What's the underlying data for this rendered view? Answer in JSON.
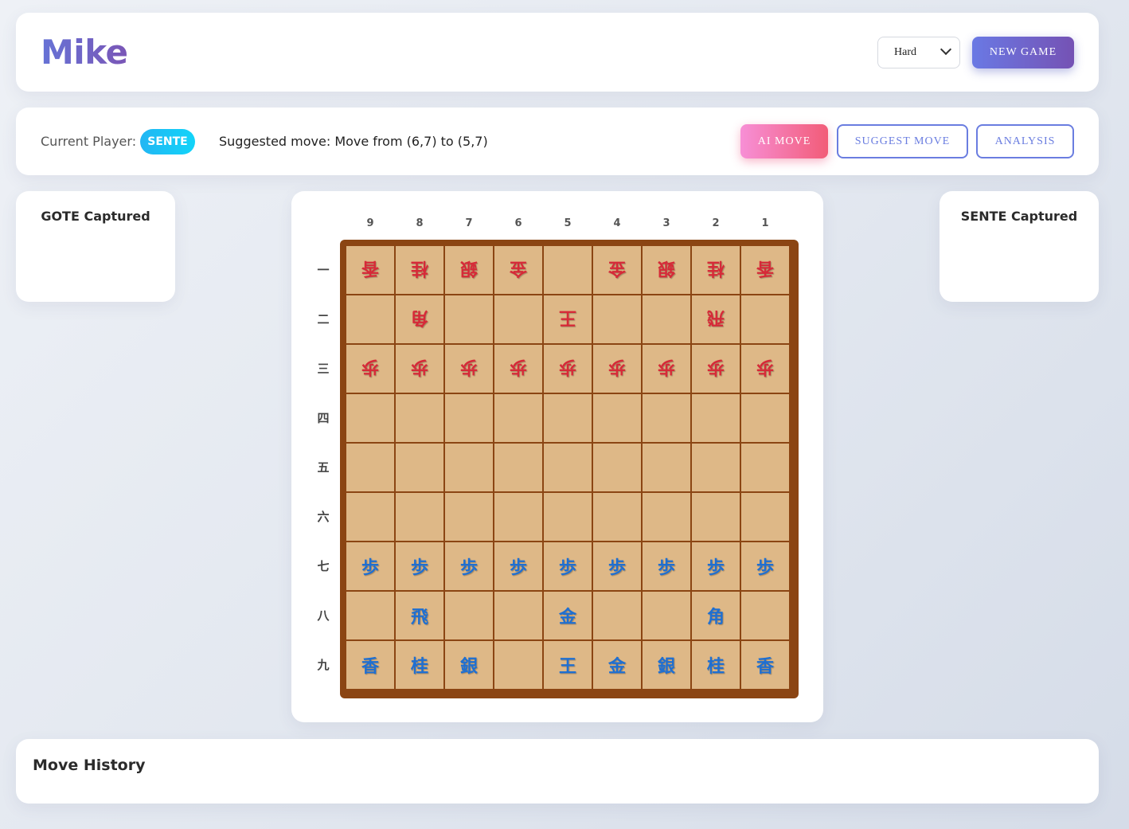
{
  "header": {
    "title": "Mike",
    "difficulty": "Hard",
    "new_game_label": "NEW GAME"
  },
  "status": {
    "current_player_label": "Current Player:",
    "current_player": "SENTE",
    "suggested_move": "Suggested move: Move from (6,7) to (5,7)",
    "ai_move_label": "AI MOVE",
    "suggest_move_label": "SUGGEST MOVE",
    "analysis_label": "ANALYSIS"
  },
  "captured": {
    "gote_title": "GOTE Captured",
    "sente_title": "SENTE Captured"
  },
  "board": {
    "files": [
      "9",
      "8",
      "7",
      "6",
      "5",
      "4",
      "3",
      "2",
      "1"
    ],
    "ranks": [
      "一",
      "二",
      "三",
      "四",
      "五",
      "六",
      "七",
      "八",
      "九"
    ],
    "rows": [
      [
        {
          "p": "香",
          "o": "gote"
        },
        {
          "p": "桂",
          "o": "gote"
        },
        {
          "p": "銀",
          "o": "gote"
        },
        {
          "p": "金",
          "o": "gote"
        },
        null,
        {
          "p": "金",
          "o": "gote"
        },
        {
          "p": "銀",
          "o": "gote"
        },
        {
          "p": "桂",
          "o": "gote"
        },
        {
          "p": "香",
          "o": "gote"
        }
      ],
      [
        null,
        {
          "p": "角",
          "o": "gote"
        },
        null,
        null,
        {
          "p": "王",
          "o": "gote"
        },
        null,
        null,
        {
          "p": "飛",
          "o": "gote"
        },
        null
      ],
      [
        {
          "p": "歩",
          "o": "gote"
        },
        {
          "p": "歩",
          "o": "gote"
        },
        {
          "p": "歩",
          "o": "gote"
        },
        {
          "p": "歩",
          "o": "gote"
        },
        {
          "p": "歩",
          "o": "gote"
        },
        {
          "p": "歩",
          "o": "gote"
        },
        {
          "p": "歩",
          "o": "gote"
        },
        {
          "p": "歩",
          "o": "gote"
        },
        {
          "p": "歩",
          "o": "gote"
        }
      ],
      [
        null,
        null,
        null,
        null,
        null,
        null,
        null,
        null,
        null
      ],
      [
        null,
        null,
        null,
        null,
        null,
        null,
        null,
        null,
        null
      ],
      [
        null,
        null,
        null,
        null,
        null,
        null,
        null,
        null,
        null
      ],
      [
        {
          "p": "歩",
          "o": "sente"
        },
        {
          "p": "歩",
          "o": "sente"
        },
        {
          "p": "歩",
          "o": "sente"
        },
        {
          "p": "歩",
          "o": "sente"
        },
        {
          "p": "歩",
          "o": "sente"
        },
        {
          "p": "歩",
          "o": "sente"
        },
        {
          "p": "歩",
          "o": "sente"
        },
        {
          "p": "歩",
          "o": "sente"
        },
        {
          "p": "歩",
          "o": "sente"
        }
      ],
      [
        null,
        {
          "p": "飛",
          "o": "sente"
        },
        null,
        null,
        {
          "p": "金",
          "o": "sente"
        },
        null,
        null,
        {
          "p": "角",
          "o": "sente"
        },
        null
      ],
      [
        {
          "p": "香",
          "o": "sente"
        },
        {
          "p": "桂",
          "o": "sente"
        },
        {
          "p": "銀",
          "o": "sente"
        },
        null,
        {
          "p": "王",
          "o": "sente"
        },
        {
          "p": "金",
          "o": "sente"
        },
        {
          "p": "銀",
          "o": "sente"
        },
        {
          "p": "桂",
          "o": "sente"
        },
        {
          "p": "香",
          "o": "sente"
        }
      ]
    ]
  },
  "history": {
    "title": "Move History"
  },
  "colors": {
    "board_frame": "#8b4513",
    "square": "#deb887",
    "sente": "#1f6fd1",
    "gote": "#d62a38"
  }
}
